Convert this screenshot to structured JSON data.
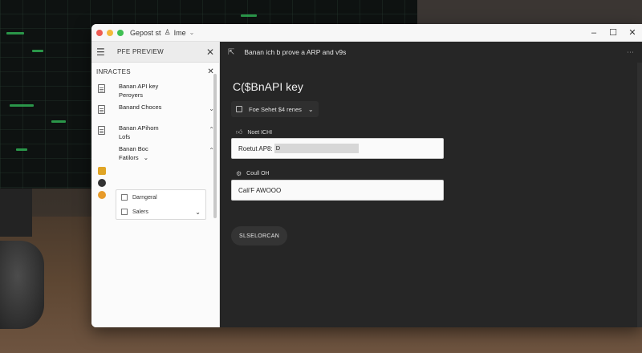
{
  "window": {
    "app_title": "Gepost st",
    "app_title_tail": "Ime",
    "controls": {
      "minimize": "–",
      "maximize": "☐",
      "close": "✕"
    }
  },
  "sidebar": {
    "header_title": "PFE PREVIEW",
    "section_title": "INRACTES",
    "items": [
      {
        "line1": "Banan API key",
        "line2": "Peroyers",
        "chevron": ""
      },
      {
        "line1": "Banand Choces",
        "line2": "",
        "chevron": "⌄"
      },
      {
        "line1": "Banan APihom",
        "line2": "Lofs",
        "chevron": "⌃"
      },
      {
        "line1": "Banan Boc",
        "line2": "Fatilors",
        "line2_chevron": "⌄",
        "chevron": "⌃"
      }
    ],
    "subitems": [
      {
        "label": "Darngeral",
        "chevron": ""
      },
      {
        "label": "Salers",
        "chevron": "⌄"
      }
    ]
  },
  "main": {
    "top_text": "Banan ich b prove a ARP and v9s",
    "heading": "C($BnAPI key",
    "dropdown_label": "Foe Sehet $4 renes",
    "field1": {
      "label": "Noet ICHI",
      "prefix": "Roetut AP8:",
      "value": "D"
    },
    "field2": {
      "label": "Coull OH",
      "value": "Cali'F AWOOO"
    },
    "select_button": "SLSELORCAN"
  },
  "colors": {
    "traffic_red": "#ee5b52",
    "traffic_yellow": "#f4b93b",
    "traffic_green": "#3fbf52",
    "main_bg": "#262626",
    "sidebar_bg": "#fbfbfb"
  }
}
